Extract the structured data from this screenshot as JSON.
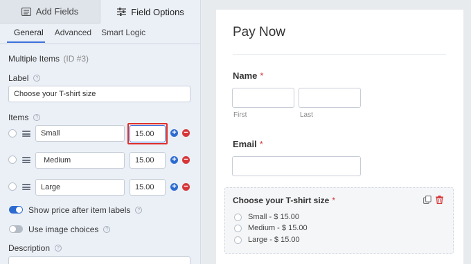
{
  "tabs": {
    "add_fields": "Add Fields",
    "field_options": "Field Options"
  },
  "subtabs": {
    "general": "General",
    "advanced": "Advanced",
    "smart_logic": "Smart Logic"
  },
  "field": {
    "type_label": "Multiple Items",
    "id_label": "(ID #3)"
  },
  "label_section": {
    "label": "Label",
    "value": "Choose your T-shirt size"
  },
  "items_section": {
    "label": "Items",
    "items": [
      {
        "label": "Small",
        "price": "15.00"
      },
      {
        "label": "Medium",
        "price": "15.00"
      },
      {
        "label": "Large",
        "price": "15.00"
      }
    ]
  },
  "toggles": {
    "show_price": "Show price after item labels",
    "image_choices": "Use image choices"
  },
  "description": {
    "label": "Description"
  },
  "preview": {
    "form_title": "Pay Now",
    "name_label": "Name",
    "required_mark": "*",
    "first_label": "First",
    "last_label": "Last",
    "email_label": "Email",
    "select_label": "Choose your T-shirt size",
    "choices": [
      "Small - $ 15.00",
      "Medium - $ 15.00",
      "Large - $ 15.00"
    ]
  },
  "colors": {
    "accent": "#2d6bd0",
    "danger": "#d63638",
    "highlight": "#e0302a"
  },
  "icons": {
    "add_fields": "list-icon",
    "field_options": "sliders-icon",
    "duplicate": "duplicate-icon",
    "delete": "trash-icon"
  }
}
